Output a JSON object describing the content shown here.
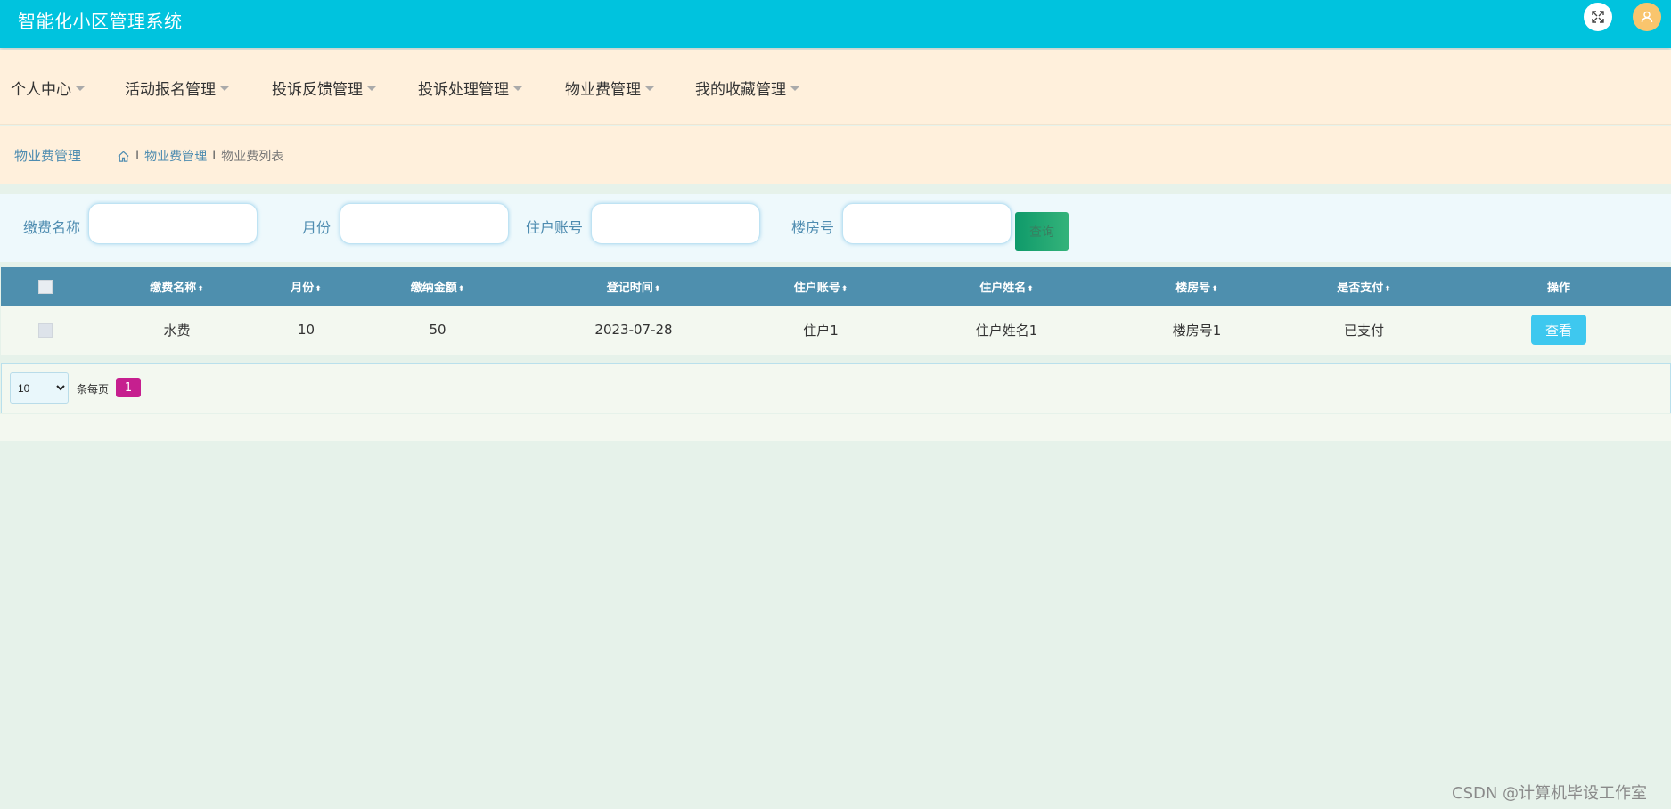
{
  "app": {
    "title": "智能化小区管理系统"
  },
  "header": {
    "fullscreen_icon": "fullscreen-icon",
    "user_icon": "user-icon",
    "user_color": "#f9c56d"
  },
  "nav": {
    "items": [
      {
        "label": "个人中心"
      },
      {
        "label": "活动报名管理"
      },
      {
        "label": "投诉反馈管理"
      },
      {
        "label": "投诉处理管理"
      },
      {
        "label": "物业费管理"
      },
      {
        "label": "我的收藏管理"
      }
    ]
  },
  "breadcrumb": {
    "title": "物业费管理",
    "home_icon": "home-icon",
    "items": [
      "物业费管理",
      "物业费列表"
    ],
    "separator": "I"
  },
  "search": {
    "fields": [
      {
        "label": "缴费名称",
        "value": ""
      },
      {
        "label": "月份",
        "value": ""
      },
      {
        "label": "住户账号",
        "value": ""
      },
      {
        "label": "楼房号",
        "value": ""
      }
    ],
    "button_label": "查询"
  },
  "table": {
    "columns": [
      "缴费名称",
      "月份",
      "缴纳金额",
      "登记时间",
      "住户账号",
      "住户姓名",
      "楼房号",
      "是否支付",
      "操作"
    ],
    "rows": [
      {
        "name": "水费",
        "month": "10",
        "amount": "50",
        "date": "2023-07-28",
        "account": "住户1",
        "resident_name": "住户姓名1",
        "building": "楼房号1",
        "paid": "已支付",
        "action": "查看"
      }
    ]
  },
  "pagination": {
    "page_size": "10",
    "per_page_label": "条每页",
    "current_page": "1"
  },
  "watermark": "CSDN @计算机毕设工作室",
  "colors": {
    "header": "#00c3de",
    "nav_bg": "#fff0dc",
    "table_header": "#4e8fae",
    "view_button": "#3ec8ef",
    "page_active": "#c61f8f",
    "search_button": "#1fa56f"
  }
}
